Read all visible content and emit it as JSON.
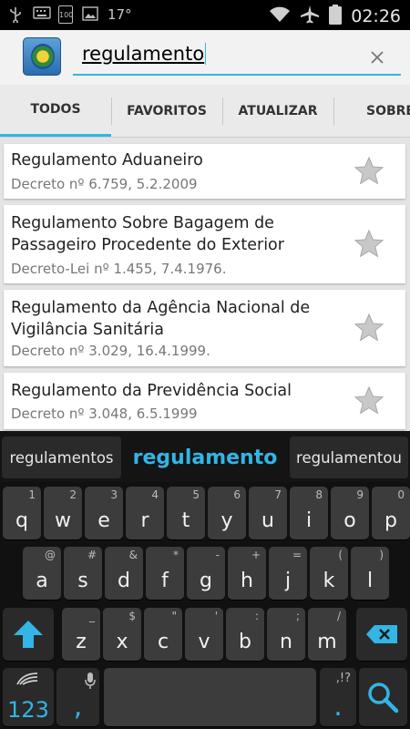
{
  "statusbar": {
    "temperature": "17°",
    "battery_small": "100",
    "time": "02:26"
  },
  "search": {
    "value": "regulamento",
    "clear_icon": "close-icon"
  },
  "tabs": [
    {
      "label": "TODOS",
      "active": true
    },
    {
      "label": "FAVORITOS",
      "active": false
    },
    {
      "label": "ATUALIZAR",
      "active": false
    },
    {
      "label": "SOBRE",
      "active": false
    }
  ],
  "results": [
    {
      "title": "Regulamento Aduaneiro",
      "subtitle": "Decreto nº 6.759, 5.2.2009"
    },
    {
      "title": "Regulamento Sobre Bagagem de Passageiro Procedente do Exterior",
      "subtitle": "Decreto-Lei nº 1.455, 7.4.1976."
    },
    {
      "title": "Regulamento da Agência Nacional de Vigilância Sanitária",
      "subtitle": "Decreto nº 3.029, 16.4.1999."
    },
    {
      "title": "Regulamento da Previdência Social",
      "subtitle": "Decreto nº 3.048, 6.5.1999"
    }
  ],
  "suggestions": {
    "left": "regulamentos",
    "center": "regulamento",
    "right": "regulamentou"
  },
  "keyboard": {
    "row1": [
      {
        "key": "q",
        "alt": "1"
      },
      {
        "key": "w",
        "alt": "2"
      },
      {
        "key": "e",
        "alt": "3"
      },
      {
        "key": "r",
        "alt": "4"
      },
      {
        "key": "t",
        "alt": "5"
      },
      {
        "key": "y",
        "alt": "6"
      },
      {
        "key": "u",
        "alt": "7"
      },
      {
        "key": "i",
        "alt": "8"
      },
      {
        "key": "o",
        "alt": "9"
      },
      {
        "key": "p",
        "alt": "0"
      }
    ],
    "row2": [
      {
        "key": "a",
        "alt": "@"
      },
      {
        "key": "s",
        "alt": "#"
      },
      {
        "key": "d",
        "alt": "&"
      },
      {
        "key": "f",
        "alt": "*"
      },
      {
        "key": "g",
        "alt": "-"
      },
      {
        "key": "h",
        "alt": "+"
      },
      {
        "key": "j",
        "alt": "="
      },
      {
        "key": "k",
        "alt": "("
      },
      {
        "key": "l",
        "alt": ")"
      }
    ],
    "row3": [
      {
        "key": "z",
        "alt": "_"
      },
      {
        "key": "x",
        "alt": "$"
      },
      {
        "key": "c",
        "alt": "\""
      },
      {
        "key": "v",
        "alt": "'"
      },
      {
        "key": "b",
        "alt": ":"
      },
      {
        "key": "n",
        "alt": ";"
      },
      {
        "key": "m",
        "alt": "/"
      }
    ],
    "numbers_key": "123",
    "comma_key": ",",
    "period_key": ".",
    "period_alt": ",!?"
  },
  "colors": {
    "accent": "#33b5e5"
  }
}
